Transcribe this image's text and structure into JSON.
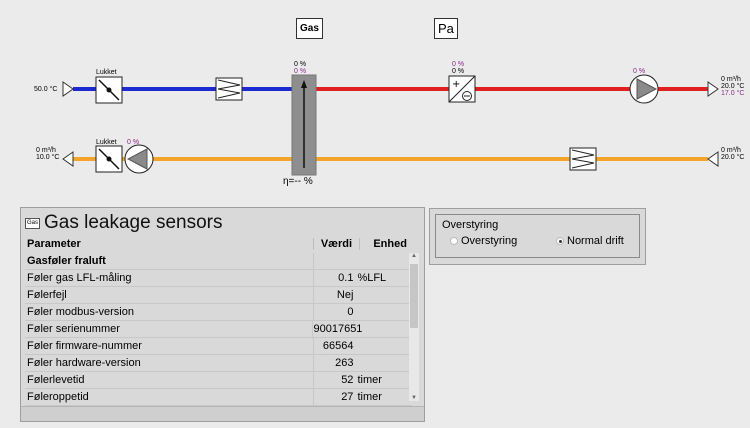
{
  "header": {
    "gas_button": "Gas",
    "pa_button": "Pa"
  },
  "supply": {
    "inlet_temp": "50.0 °C",
    "damper_label": "Lukket",
    "gas_label_top": "0 %",
    "gas_label_bottom": "0 %",
    "heater_label_top": "0 %",
    "heater_label_bottom": "0 %",
    "fan_label": "0 %",
    "out_flow": "0 m³/h",
    "out_temp": "20.0 °C",
    "out_temp2": "17.0 °C"
  },
  "extract": {
    "inlet_flow": "0 m³/h",
    "inlet_temp": "10.0 °C",
    "damper_label": "Lukket",
    "fan_label": "0 %",
    "out_flow": "0 m³/h",
    "out_temp": "20.0 °C"
  },
  "exchanger": {
    "efficiency": "η=-- %"
  },
  "panel": {
    "icon_label": "Gas",
    "title": "Gas leakage sensors",
    "col_param": "Parameter",
    "col_value": "Værdi",
    "col_unit": "Enhed",
    "rows": [
      {
        "param": "Gasføler fraluft",
        "value": "",
        "unit": ""
      },
      {
        "param": "Føler gas LFL-måling",
        "value": "0.1",
        "unit": "%LFL"
      },
      {
        "param": "Følerfejl",
        "value": "Nej",
        "unit": ""
      },
      {
        "param": "Føler modbus-version",
        "value": "0",
        "unit": ""
      },
      {
        "param": "Føler serienummer",
        "value": "90017651",
        "unit": ""
      },
      {
        "param": "Føler firmware-nummer",
        "value": "66564",
        "unit": ""
      },
      {
        "param": "Føler hardware-version",
        "value": "263",
        "unit": ""
      },
      {
        "param": "Følerlevetid",
        "value": "52",
        "unit": "timer"
      },
      {
        "param": "Føleroppetid",
        "value": "27",
        "unit": "timer"
      }
    ]
  },
  "override": {
    "title": "Overstyring",
    "option1": "Overstyring",
    "option2": "Normal drift",
    "selected": "Normal drift"
  },
  "colors": {
    "supply_pipe": "#e02020",
    "intake_pipe": "#1a2ad0",
    "extract_pipe": "#f4a428",
    "fan_grey": "#888888"
  }
}
